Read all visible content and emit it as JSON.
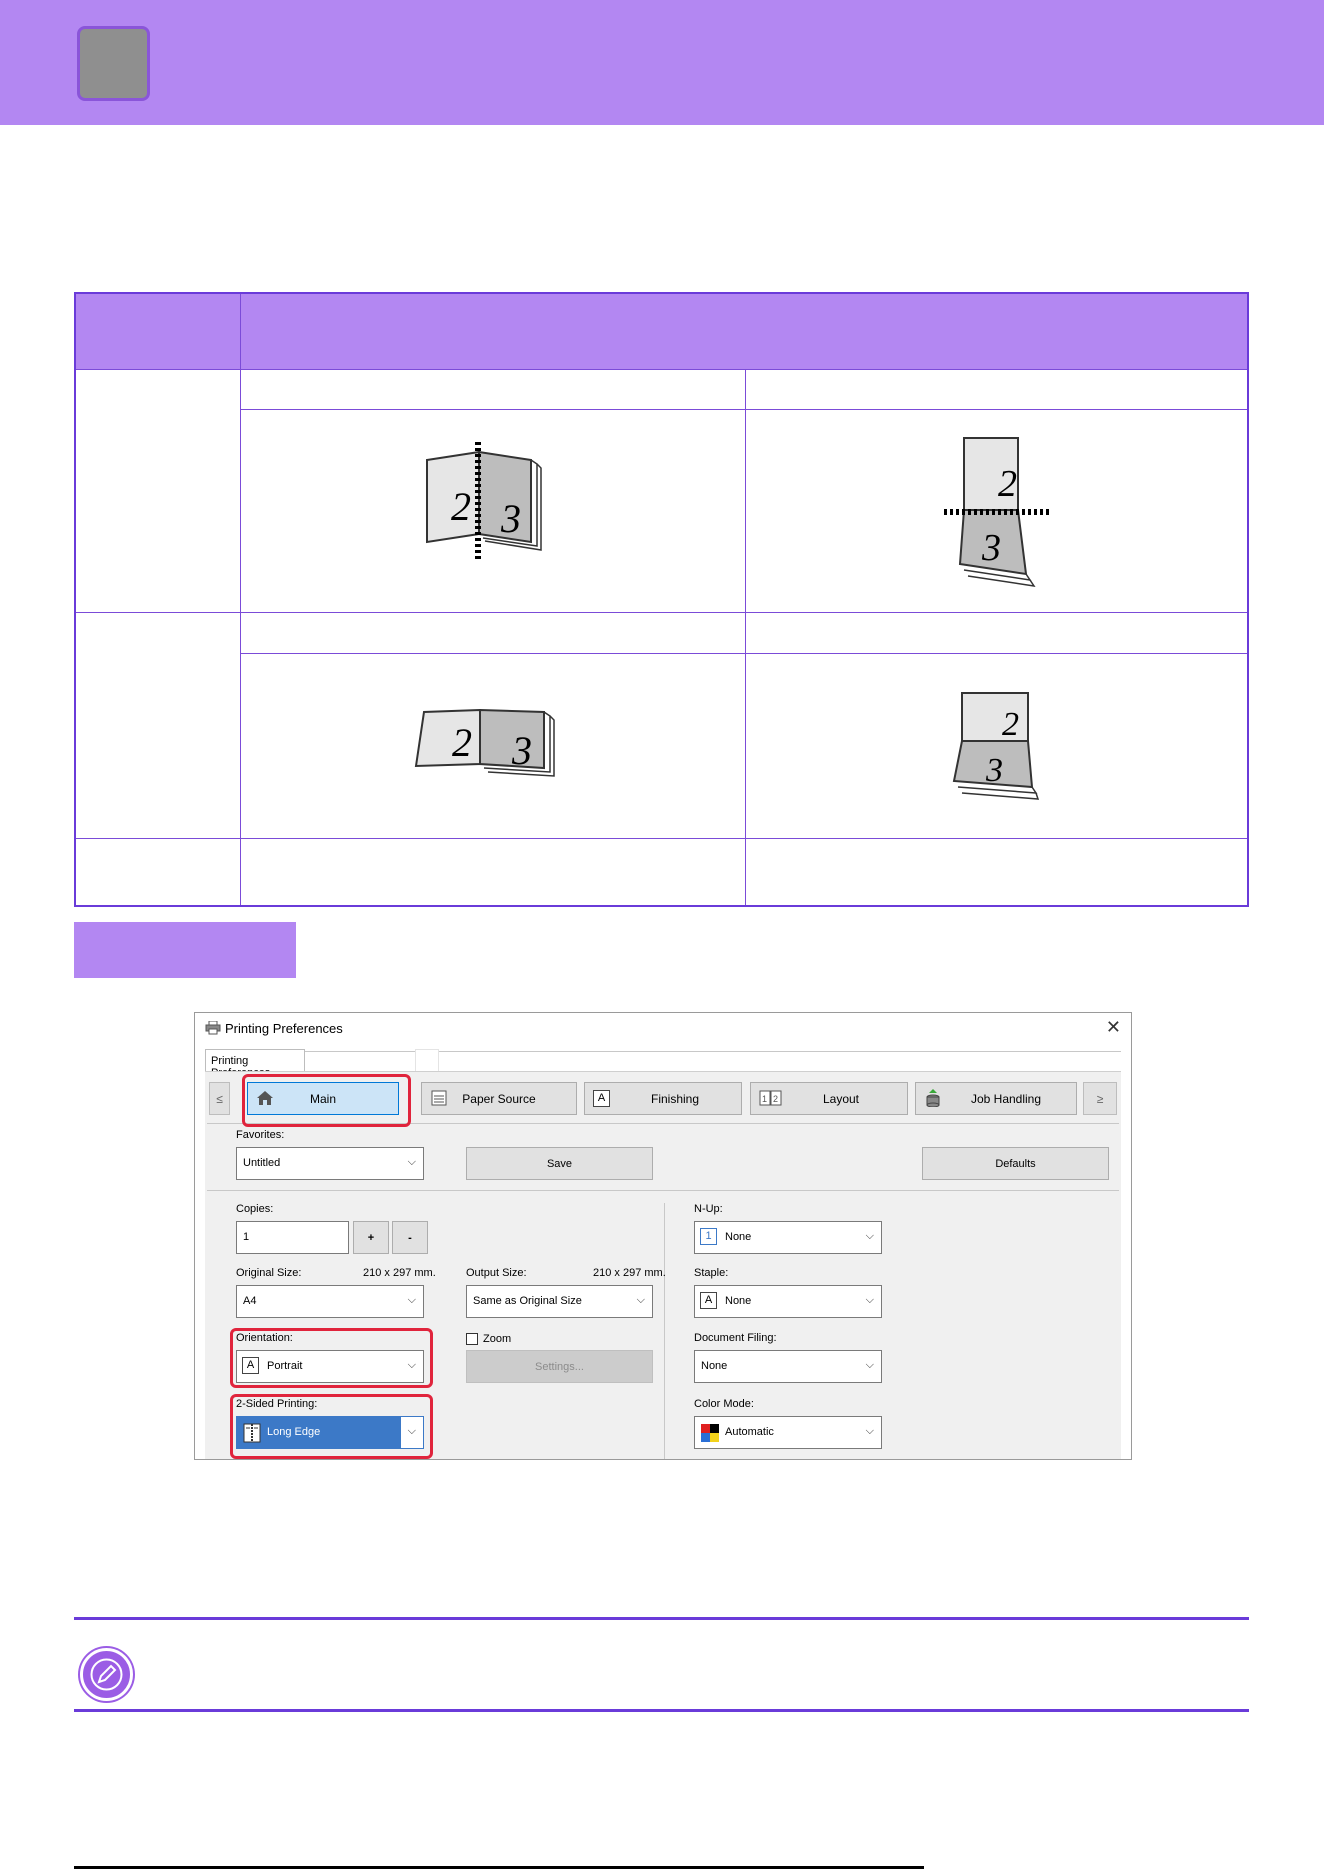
{
  "colors": {
    "banner": "#b387f2",
    "table_border": "#6a3bd9",
    "highlight_red": "#e0243c",
    "selected_blue": "#3c79c7"
  },
  "dialog": {
    "title": "Printing Preferences",
    "tab_label": "Printing Preferences",
    "nav": {
      "prev": "≤",
      "next": "≥",
      "tabs": [
        {
          "label": "Main",
          "icon": "home-icon"
        },
        {
          "label": "Paper Source",
          "icon": "paper-tray-icon"
        },
        {
          "label": "Finishing",
          "icon": "finishing-icon"
        },
        {
          "label": "Layout",
          "icon": "layout-icon"
        },
        {
          "label": "Job Handling",
          "icon": "job-handling-icon"
        }
      ]
    },
    "favorites": {
      "label": "Favorites:",
      "value": "Untitled"
    },
    "save_button": "Save",
    "defaults_button": "Defaults",
    "copies": {
      "label": "Copies:",
      "value": "1",
      "plus": "+",
      "minus": "-"
    },
    "original_size": {
      "label": "Original Size:",
      "dims": "210 x 297 mm.",
      "value": "A4"
    },
    "output_size": {
      "label": "Output Size:",
      "dims": "210 x 297 mm.",
      "value": "Same as Original Size"
    },
    "orientation": {
      "label": "Orientation:",
      "value": "Portrait",
      "icon": "portrait-icon"
    },
    "zoom": {
      "label": "Zoom",
      "checked": false,
      "settings_button": "Settings..."
    },
    "two_sided": {
      "label": "2-Sided Printing:",
      "value": "Long Edge",
      "icon": "long-edge-icon"
    },
    "n_up": {
      "label": "N-Up:",
      "value": "None",
      "icon": "nup-icon",
      "icon_text": "1"
    },
    "staple": {
      "label": "Staple:",
      "value": "None",
      "icon": "staple-icon"
    },
    "document_filing": {
      "label": "Document Filing:",
      "value": "None"
    },
    "color_mode": {
      "label": "Color Mode:",
      "value": "Automatic",
      "icon": "color-mode-icon"
    }
  },
  "booklet_figures": {
    "pages": [
      "2",
      "3"
    ]
  }
}
